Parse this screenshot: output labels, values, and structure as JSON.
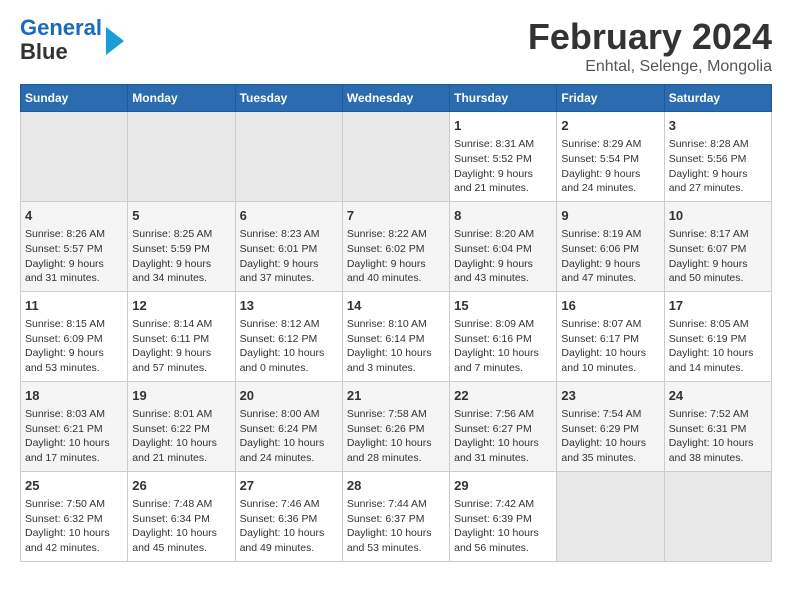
{
  "logo": {
    "line1": "General",
    "line2": "Blue"
  },
  "title": "February 2024",
  "subtitle": "Enhtal, Selenge, Mongolia",
  "headers": [
    "Sunday",
    "Monday",
    "Tuesday",
    "Wednesday",
    "Thursday",
    "Friday",
    "Saturday"
  ],
  "weeks": [
    [
      {
        "day": "",
        "info": ""
      },
      {
        "day": "",
        "info": ""
      },
      {
        "day": "",
        "info": ""
      },
      {
        "day": "",
        "info": ""
      },
      {
        "day": "1",
        "info": "Sunrise: 8:31 AM\nSunset: 5:52 PM\nDaylight: 9 hours\nand 21 minutes."
      },
      {
        "day": "2",
        "info": "Sunrise: 8:29 AM\nSunset: 5:54 PM\nDaylight: 9 hours\nand 24 minutes."
      },
      {
        "day": "3",
        "info": "Sunrise: 8:28 AM\nSunset: 5:56 PM\nDaylight: 9 hours\nand 27 minutes."
      }
    ],
    [
      {
        "day": "4",
        "info": "Sunrise: 8:26 AM\nSunset: 5:57 PM\nDaylight: 9 hours\nand 31 minutes."
      },
      {
        "day": "5",
        "info": "Sunrise: 8:25 AM\nSunset: 5:59 PM\nDaylight: 9 hours\nand 34 minutes."
      },
      {
        "day": "6",
        "info": "Sunrise: 8:23 AM\nSunset: 6:01 PM\nDaylight: 9 hours\nand 37 minutes."
      },
      {
        "day": "7",
        "info": "Sunrise: 8:22 AM\nSunset: 6:02 PM\nDaylight: 9 hours\nand 40 minutes."
      },
      {
        "day": "8",
        "info": "Sunrise: 8:20 AM\nSunset: 6:04 PM\nDaylight: 9 hours\nand 43 minutes."
      },
      {
        "day": "9",
        "info": "Sunrise: 8:19 AM\nSunset: 6:06 PM\nDaylight: 9 hours\nand 47 minutes."
      },
      {
        "day": "10",
        "info": "Sunrise: 8:17 AM\nSunset: 6:07 PM\nDaylight: 9 hours\nand 50 minutes."
      }
    ],
    [
      {
        "day": "11",
        "info": "Sunrise: 8:15 AM\nSunset: 6:09 PM\nDaylight: 9 hours\nand 53 minutes."
      },
      {
        "day": "12",
        "info": "Sunrise: 8:14 AM\nSunset: 6:11 PM\nDaylight: 9 hours\nand 57 minutes."
      },
      {
        "day": "13",
        "info": "Sunrise: 8:12 AM\nSunset: 6:12 PM\nDaylight: 10 hours\nand 0 minutes."
      },
      {
        "day": "14",
        "info": "Sunrise: 8:10 AM\nSunset: 6:14 PM\nDaylight: 10 hours\nand 3 minutes."
      },
      {
        "day": "15",
        "info": "Sunrise: 8:09 AM\nSunset: 6:16 PM\nDaylight: 10 hours\nand 7 minutes."
      },
      {
        "day": "16",
        "info": "Sunrise: 8:07 AM\nSunset: 6:17 PM\nDaylight: 10 hours\nand 10 minutes."
      },
      {
        "day": "17",
        "info": "Sunrise: 8:05 AM\nSunset: 6:19 PM\nDaylight: 10 hours\nand 14 minutes."
      }
    ],
    [
      {
        "day": "18",
        "info": "Sunrise: 8:03 AM\nSunset: 6:21 PM\nDaylight: 10 hours\nand 17 minutes."
      },
      {
        "day": "19",
        "info": "Sunrise: 8:01 AM\nSunset: 6:22 PM\nDaylight: 10 hours\nand 21 minutes."
      },
      {
        "day": "20",
        "info": "Sunrise: 8:00 AM\nSunset: 6:24 PM\nDaylight: 10 hours\nand 24 minutes."
      },
      {
        "day": "21",
        "info": "Sunrise: 7:58 AM\nSunset: 6:26 PM\nDaylight: 10 hours\nand 28 minutes."
      },
      {
        "day": "22",
        "info": "Sunrise: 7:56 AM\nSunset: 6:27 PM\nDaylight: 10 hours\nand 31 minutes."
      },
      {
        "day": "23",
        "info": "Sunrise: 7:54 AM\nSunset: 6:29 PM\nDaylight: 10 hours\nand 35 minutes."
      },
      {
        "day": "24",
        "info": "Sunrise: 7:52 AM\nSunset: 6:31 PM\nDaylight: 10 hours\nand 38 minutes."
      }
    ],
    [
      {
        "day": "25",
        "info": "Sunrise: 7:50 AM\nSunset: 6:32 PM\nDaylight: 10 hours\nand 42 minutes."
      },
      {
        "day": "26",
        "info": "Sunrise: 7:48 AM\nSunset: 6:34 PM\nDaylight: 10 hours\nand 45 minutes."
      },
      {
        "day": "27",
        "info": "Sunrise: 7:46 AM\nSunset: 6:36 PM\nDaylight: 10 hours\nand 49 minutes."
      },
      {
        "day": "28",
        "info": "Sunrise: 7:44 AM\nSunset: 6:37 PM\nDaylight: 10 hours\nand 53 minutes."
      },
      {
        "day": "29",
        "info": "Sunrise: 7:42 AM\nSunset: 6:39 PM\nDaylight: 10 hours\nand 56 minutes."
      },
      {
        "day": "",
        "info": ""
      },
      {
        "day": "",
        "info": ""
      }
    ]
  ]
}
